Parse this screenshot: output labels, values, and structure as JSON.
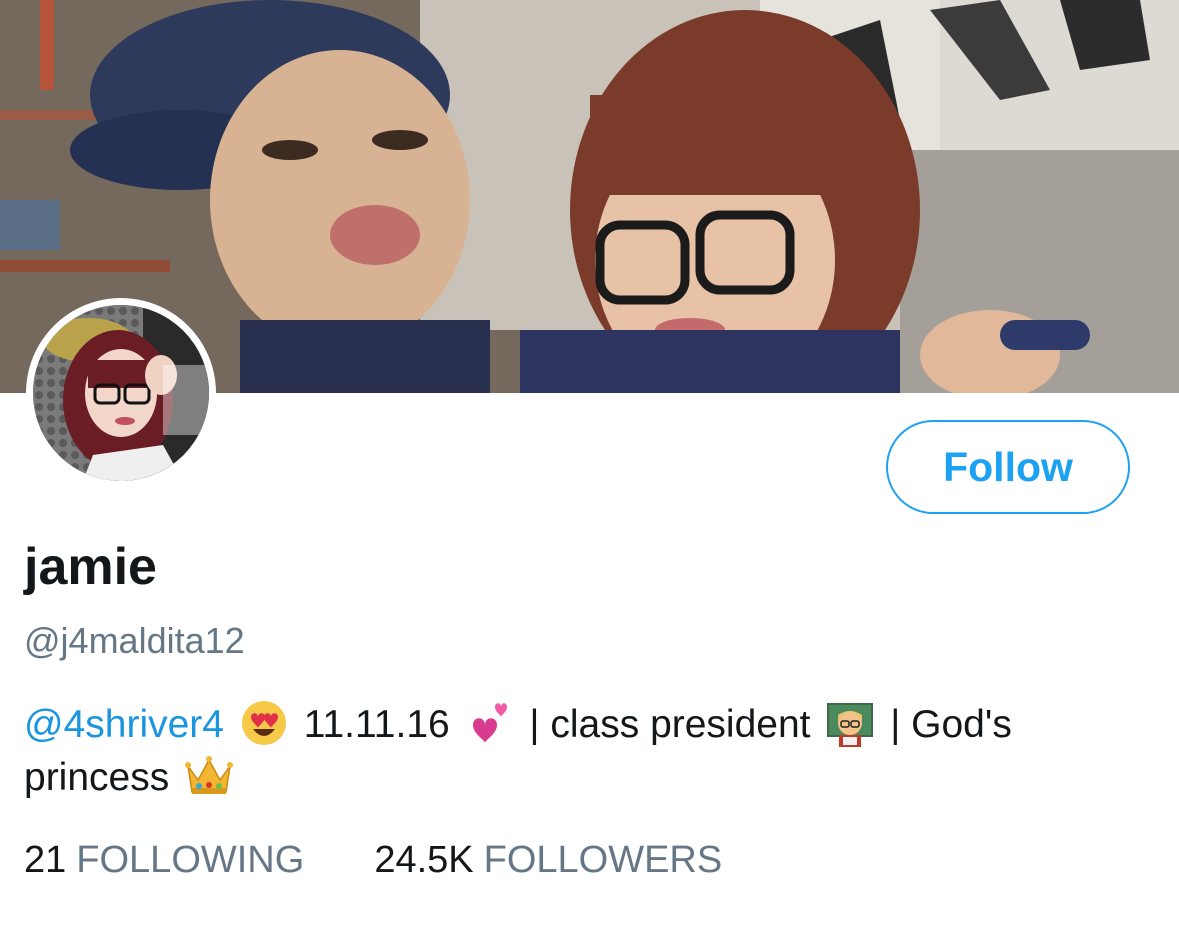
{
  "profile": {
    "display_name": "jamie",
    "handle": "@j4maldita12"
  },
  "actions": {
    "follow_label": "Follow"
  },
  "bio": {
    "mention": "@4shriver4",
    "date": "11.11.16",
    "part_class": "| class president",
    "part_god": "| God's",
    "part_princess": "princess",
    "emojis": [
      "heart-eyes-emoji",
      "two-hearts-emoji",
      "teacher-emoji",
      "crown-emoji"
    ]
  },
  "stats": {
    "following_count": "21",
    "following_label": "FOLLOWING",
    "followers_count": "24.5K",
    "followers_label": "FOLLOWERS"
  },
  "colors": {
    "accent": "#1da1f2",
    "mention": "#1b95e0",
    "secondary_text": "#657786",
    "primary_text": "#14171a"
  }
}
